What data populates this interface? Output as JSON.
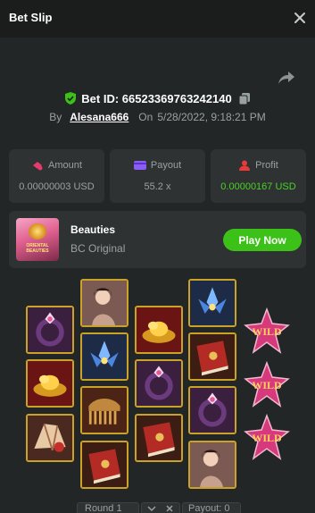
{
  "header": {
    "title": "Bet Slip"
  },
  "bet": {
    "id_text": "Bet ID: 66523369763242140",
    "by_label": "By",
    "user": "Alesana666",
    "on_label": "On",
    "datetime": "5/28/2022, 9:18:21 PM"
  },
  "stats": [
    {
      "label": "Amount",
      "value": "0.00000003 USD",
      "icon": "coins-icon"
    },
    {
      "label": "Payout",
      "value": "55.2 x",
      "icon": "wallet-icon"
    },
    {
      "label": "Profit",
      "value": "0.00000167 USD",
      "icon": "profit-icon"
    }
  ],
  "game": {
    "name": "Beauties",
    "subtitle": "BC Original",
    "play_label": "Play Now",
    "thumb_text": "ORIENTAL BEAUTIES"
  },
  "reels": {
    "symbols_col1": [
      "ring-symbol",
      "gold-ingot-symbol",
      "fan-symbol"
    ],
    "symbols_col2": [
      "lady-symbol",
      "lotus-symbol",
      "comb-symbol",
      "book-symbol"
    ],
    "symbols_col3": [
      "gold-ingot-symbol",
      "ring-symbol",
      "book-symbol"
    ],
    "symbols_col4": [
      "lotus-symbol",
      "book-symbol",
      "ring-symbol",
      "lady-symbol"
    ],
    "symbols_col5": [
      "wild-symbol",
      "wild-symbol",
      "wild-symbol"
    ],
    "wild_text": "WILD"
  },
  "round": {
    "label": "Round 1",
    "payout_label": "Payout: 0"
  },
  "colors": {
    "accent_green": "#3bc117",
    "profit_green": "#49d126",
    "tile_border": "#c9a227"
  }
}
